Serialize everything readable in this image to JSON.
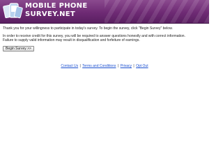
{
  "header": {
    "logo_line1": "MOBILE PHONE",
    "logo_line2": "SURVEY.NET",
    "brand_color": "#6e2a74"
  },
  "intro": {
    "line1": "Thank you for your willingness to participate in today's survey. To begin the survey, click \"Begin Survey\" below.",
    "line2": "In order to receive credit for this survey, you will be required to answer questions honestly and with correct information.",
    "line3": "Failure to supply valid information may result in disqualification and forfeiture of earnings."
  },
  "actions": {
    "begin_label": "Begin Survey >>"
  },
  "footer": {
    "contact": "Contact Us",
    "terms": "Terms and Conditions",
    "privacy": "Privacy",
    "optout": "Opt Out",
    "separator": "|"
  }
}
